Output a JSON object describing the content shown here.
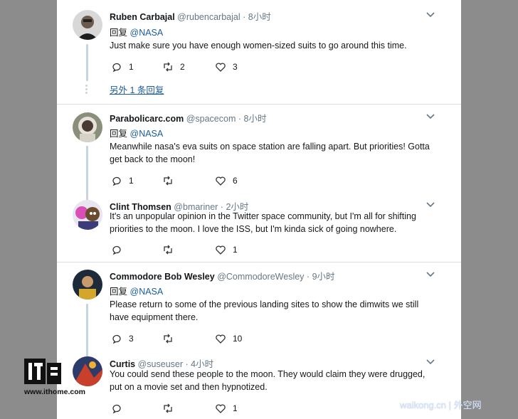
{
  "tweets": [
    {
      "name": "Ruben Carbajal",
      "handle": "@rubencarbajal",
      "time": "8小时",
      "reply_prefix": "回复",
      "reply_to": "@NASA",
      "body": "Just make sure you have enough women-sized suits to go around this time.",
      "replies": "1",
      "retweets": "2",
      "likes": "3",
      "more_replies": "另外 1 条回复"
    },
    {
      "name": "Parabolicarc.com",
      "handle": "@spacecom",
      "time": "8小时",
      "reply_prefix": "回复",
      "reply_to": "@NASA",
      "body": "Meanwhile nasa's eva suits on space station are falling apart. But priorities! Gotta get back to the moon!",
      "replies": "1",
      "retweets": "",
      "likes": "6"
    },
    {
      "name": "Clint Thomsen",
      "handle": "@bmariner",
      "time": "2小时",
      "body": "It's an unpopular opinion in the Twitter space community, but I'm all for shifting priorities to the moon. I love the ISS, but I'm kinda sick of going nowhere.",
      "replies": "",
      "retweets": "",
      "likes": "1"
    },
    {
      "name": "Commodore Bob Wesley",
      "handle": "@CommodoreWesley",
      "time": "9小时",
      "reply_prefix": "回复",
      "reply_to": "@NASA",
      "body": "Please return to some of the previous landing sites to show the dimwits we still have equipment there.",
      "replies": "3",
      "retweets": "",
      "likes": "10"
    },
    {
      "name": "Curtis",
      "handle": "@suseuser",
      "time": "4小时",
      "body": "You could send these people to the moon. They would claim they were drugged, put on a movie set and then hypnotized.",
      "replies": "",
      "retweets": "",
      "likes": "1"
    }
  ],
  "separator": "·",
  "icons": [
    "reply-icon",
    "retweet-icon",
    "like-icon",
    "chevron-down-icon"
  ],
  "colors": {
    "link": "#1b5c98",
    "thread_line": "#c8d4e0",
    "muted": "#657786",
    "background": "#8c8c8c"
  },
  "watermarks": {
    "left_logo": "IT之家",
    "left_url": "www.ithome.com",
    "right": "waikong.cn | 外空网"
  }
}
